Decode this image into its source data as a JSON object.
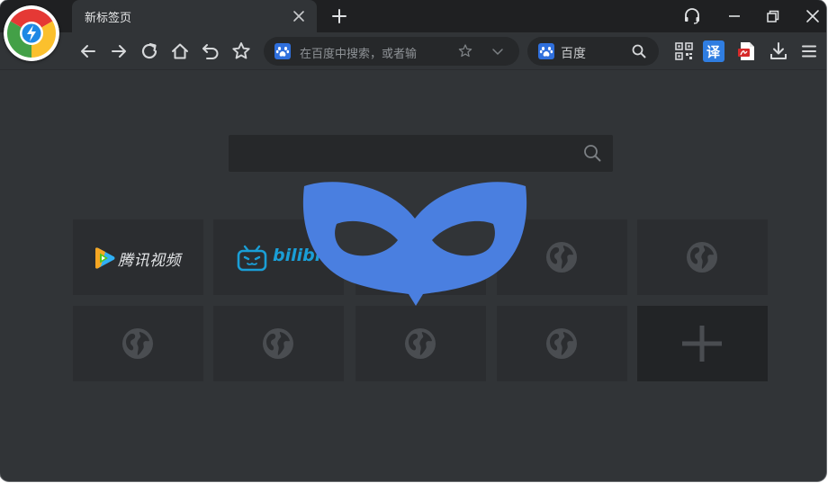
{
  "window": {
    "accent_color": "#4a7fe0"
  },
  "tabs": [
    {
      "title": "新标签页",
      "active": true,
      "icon": "close-icon"
    }
  ],
  "titlebar": {
    "icons": [
      "headset-icon",
      "minimize-icon",
      "restore-icon",
      "close-icon"
    ]
  },
  "toolbar": {
    "nav_icons": [
      "back-arrow-icon",
      "forward-arrow-icon",
      "reload-icon",
      "home-icon",
      "undo-icon",
      "star-icon"
    ],
    "address_bar": {
      "placeholder": "在百度中搜索，或者输",
      "engine_icon": "baidu-paw-icon",
      "trailing_icons": [
        "star-outline-icon",
        "chevron-down-icon"
      ]
    },
    "search_box": {
      "engine_label": "百度",
      "engine_icon": "baidu-paw-icon",
      "action_icon": "search-icon"
    },
    "extensions": [
      "qr-code-icon",
      "translate-icon",
      "pdf-icon",
      "download-icon",
      "menu-icon"
    ],
    "translate_label": "译"
  },
  "new_tab_page": {
    "search_icon": "search-icon",
    "tiles": [
      {
        "label": "腾讯视频",
        "icon": "tencent-video-icon"
      },
      {
        "label": "bilibili",
        "icon": "bilibili-tv-icon"
      },
      {
        "label": "",
        "icon": "globe-icon"
      },
      {
        "label": "",
        "icon": "globe-icon"
      },
      {
        "label": "",
        "icon": "globe-icon"
      },
      {
        "label": "",
        "icon": "globe-icon"
      },
      {
        "label": "",
        "icon": "globe-icon"
      },
      {
        "label": "",
        "icon": "globe-icon"
      },
      {
        "label": "",
        "icon": "globe-icon"
      },
      {
        "label": "",
        "icon": "plus-icon"
      }
    ]
  },
  "overlay": {
    "icon": "incognito-mask-icon",
    "color": "#4a7fe0"
  }
}
